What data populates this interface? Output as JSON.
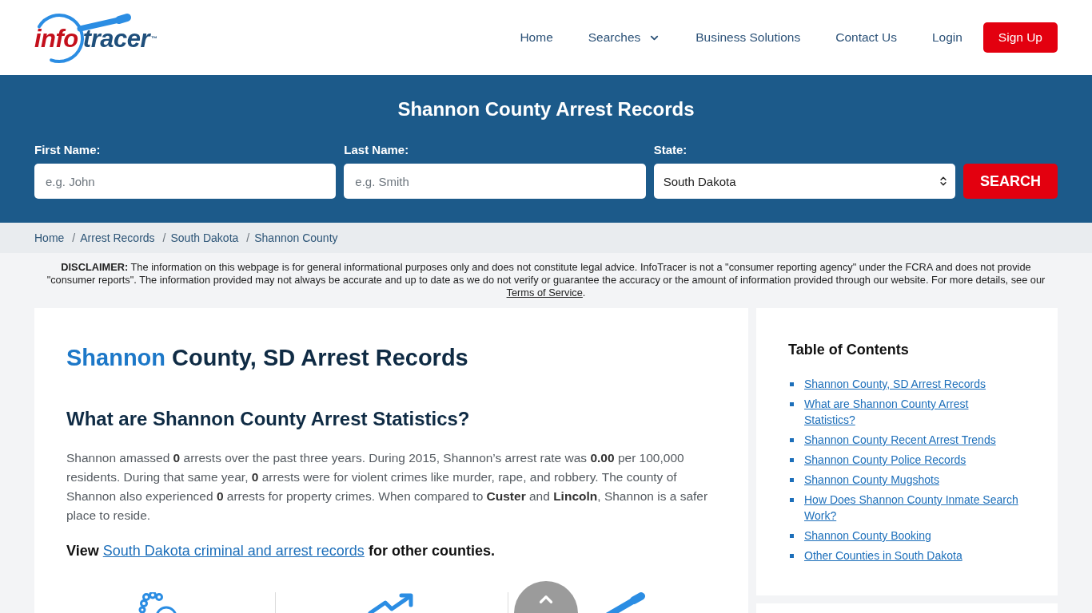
{
  "header": {
    "logo": {
      "first": "info",
      "second": "tracer",
      "mark": "™"
    },
    "nav": [
      {
        "label": "Home",
        "kind": "link"
      },
      {
        "label": "Searches",
        "kind": "dropdown"
      },
      {
        "label": "Business Solutions",
        "kind": "link"
      },
      {
        "label": "Contact Us",
        "kind": "link"
      },
      {
        "label": "Login",
        "kind": "link"
      },
      {
        "label": "Sign Up",
        "kind": "button"
      }
    ]
  },
  "search": {
    "title": "Shannon County Arrest Records",
    "fields": [
      {
        "kind": "text",
        "label": "First Name:",
        "placeholder": "e.g. John"
      },
      {
        "kind": "text",
        "label": "Last Name:",
        "placeholder": "e.g. Smith"
      },
      {
        "kind": "select",
        "label": "State:",
        "value": "South Dakota"
      }
    ],
    "button": "SEARCH"
  },
  "breadcrumb": {
    "separator": "/",
    "items": [
      "Home",
      "Arrest Records",
      "South Dakota",
      "Shannon County"
    ]
  },
  "disclaimer": {
    "text": "**DISCLAIMER:** The information on this webpage is for general informational purposes only and does not constitute legal advice. InfoTracer is not a \"consumer reporting agency\" under the FCRA and does not provide \"consumer reports\". The information provided may not always be accurate and up to date as we do not verify or guarantee the accuracy or the amount of information provided through our website. For more details, see our",
    "link": "Terms of Service",
    "end": "."
  },
  "article": {
    "title_highlight": "Shannon",
    "title": "County, SD Arrest Records",
    "heading": "What are Shannon County Arrest Statistics?",
    "paragraph": "Shannon amassed **0** arrests over the past three years. During 2015, Shannon’s arrest rate was **0.00** per 100,000 residents. During that same year, **0** arrests were for violent crimes like murder, rape, and robbery. The county of Shannon also experienced **0** arrests for property crimes. When compared to **Custer** and **Lincoln**, Shannon is a safer place to reside.",
    "view": {
      "before": "View",
      "link": "South Dakota criminal and arrest records",
      "after": "for other counties."
    }
  },
  "toc": {
    "title": "Table of Contents",
    "items": [
      "Shannon County, SD Arrest Records",
      "What are Shannon County Arrest Statistics?",
      "Shannon County Recent Arrest Trends",
      "Shannon County Police Records",
      "Shannon County Mugshots",
      "How Does Shannon County Inmate Search Work?",
      "Shannon County Booking",
      "Other Counties in South Dakota"
    ]
  }
}
